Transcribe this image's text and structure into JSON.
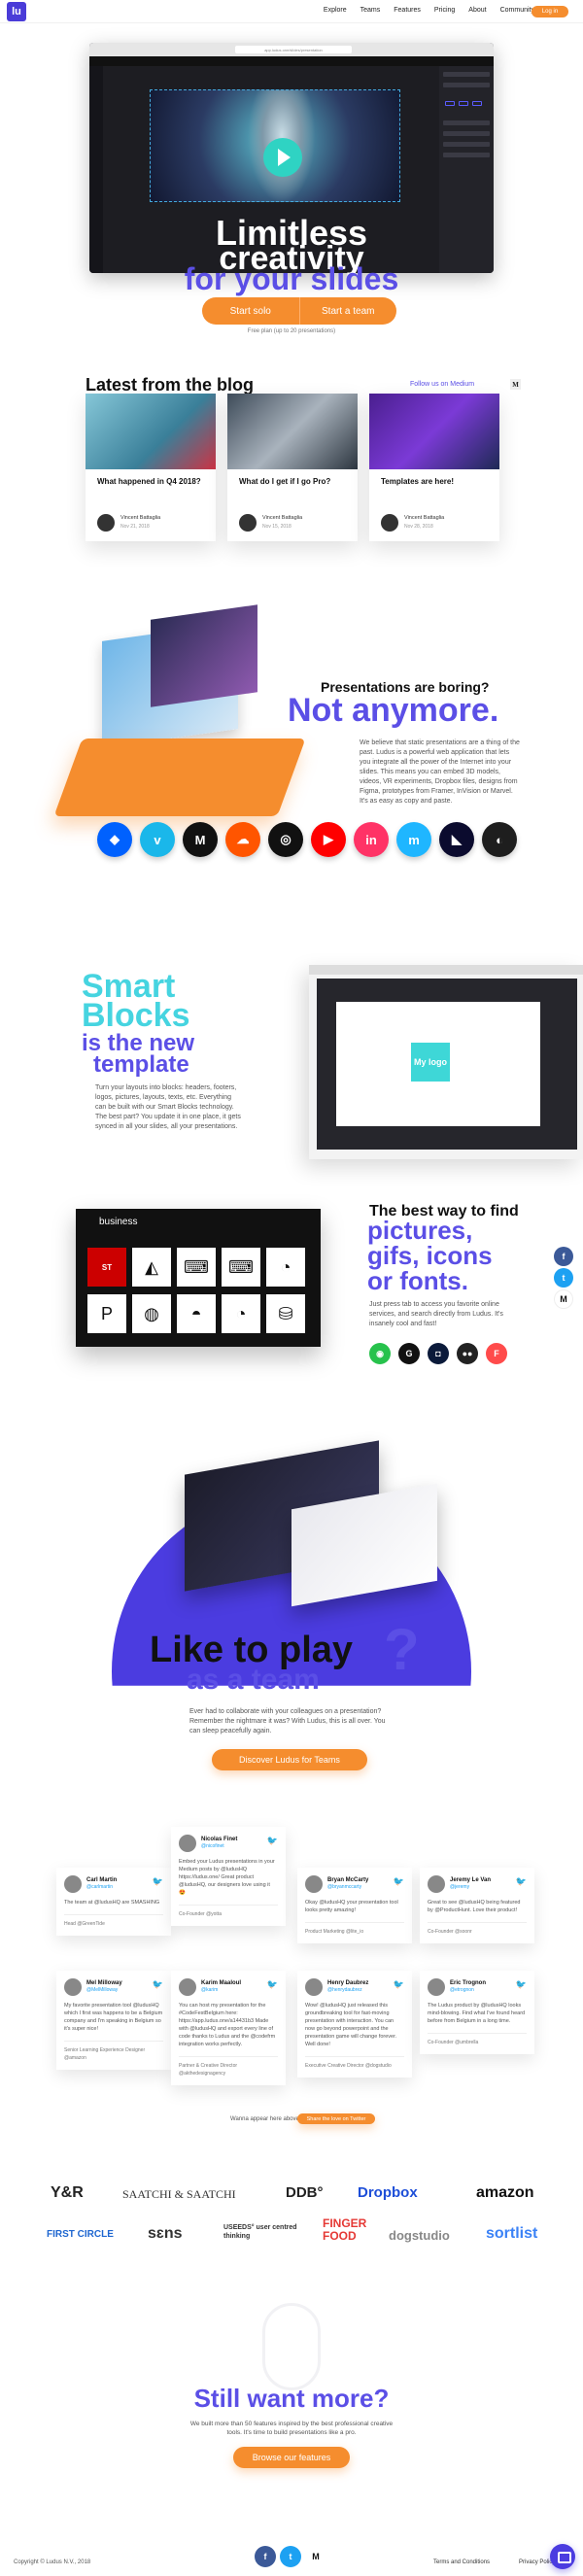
{
  "header": {
    "logo": "lu",
    "nav": [
      "Explore",
      "Teams",
      "Features",
      "Pricing",
      "About",
      "Community"
    ],
    "login": "Log in"
  },
  "hero": {
    "url": "app.ludus.one/slides/presentation",
    "line1": "Limitless",
    "line2": "creativity",
    "line3": "for your slides",
    "btn_solo": "Start solo",
    "btn_team": "Start a team",
    "note": "Free plan (up to 20 presentations)"
  },
  "blog": {
    "title": "Latest from the blog",
    "follow": "Follow us on Medium",
    "m": "M",
    "posts": [
      {
        "title": "What happened in Q4 2018?",
        "author": "Vincent Battaglia",
        "date": "Nov 21, 2018",
        "color": "#5aa9c7"
      },
      {
        "title": "What do I get if I go Pro?",
        "author": "Vincent Battaglia",
        "date": "Nov 15, 2018",
        "color": "#3e4b59"
      },
      {
        "title": "Templates are here!",
        "author": "Vincent Battaglia",
        "date": "Nov 28, 2018",
        "color": "#6b2fb8"
      }
    ]
  },
  "boring": {
    "small": "Presentations are boring?",
    "big": "Not anymore.",
    "para": "We believe that static presentations are a thing of the past. Ludus is a powerful web application that lets you integrate all the power of the Internet into your slides. This means you can embed 3D models, videos, VR experiments, Dropbox files, designs from Figma, prototypes from Framer, InVision or Marvel. It's as easy as copy and paste.",
    "services": [
      {
        "glyph": "◆",
        "color": "#0061fe"
      },
      {
        "glyph": "v",
        "color": "#1ab7ea"
      },
      {
        "glyph": "M",
        "color": "#111111"
      },
      {
        "glyph": "☁",
        "color": "#ff5500"
      },
      {
        "glyph": "◎",
        "color": "#111111"
      },
      {
        "glyph": "▶",
        "color": "#ff0000"
      },
      {
        "glyph": "in",
        "color": "#ff3366"
      },
      {
        "glyph": "m",
        "color": "#1fb6ff"
      },
      {
        "glyph": "◣",
        "color": "#0b0b2e"
      },
      {
        "glyph": "◐",
        "color": "#1e1e1e"
      }
    ]
  },
  "smart": {
    "l1": "Smart",
    "l2": "Blocks",
    "l3": "is the new",
    "l4": "template",
    "para": "Turn your layouts into blocks: headers, footers, logos, pictures, layouts, texts, etc. Everything can be built with our Smart Blocks technology. The best part? You update it in one place, it gets synced in all your slides, all your presentations.",
    "tile": "My logo"
  },
  "find": {
    "search": "business",
    "icons": [
      "ST",
      "◭",
      "⌨",
      "⌨",
      "◔",
      "P",
      "◍",
      "◓",
      "◔",
      "⛁"
    ],
    "l1": "The best way to find",
    "l2": "pictures, gifs, icons or fonts.",
    "para": "Just press tab to access you favorite online services, and search directly from Ludus. It's insanely cool and fast!",
    "sources": [
      {
        "glyph": "◉",
        "color": "#27c24c"
      },
      {
        "glyph": "G",
        "color": "#111111"
      },
      {
        "glyph": "◘",
        "color": "#0b1a3a"
      },
      {
        "glyph": "●●",
        "color": "#222222"
      },
      {
        "glyph": "F",
        "color": "#ff4b4b"
      }
    ],
    "share": [
      {
        "glyph": "f",
        "color": "#3b5998"
      },
      {
        "glyph": "t",
        "color": "#1da1f2"
      },
      {
        "glyph": "M",
        "color": "#111111"
      }
    ]
  },
  "teams": {
    "l1": "Like to play",
    "q": "?",
    "l2": "as a team",
    "para": "Ever had to collaborate with your colleagues on a presentation? Remember the nightmare it was? With Ludus, this is all over. You can sleep peacefully again.",
    "btn": "Discover Ludus for Teams"
  },
  "tweets": [
    {
      "name": "Carl Martin",
      "handle": "@carlmartin",
      "text": "The team at @ludusHQ are SMASHING",
      "foot": "Head @GreenTide"
    },
    {
      "name": "Nicolas Finet",
      "handle": "@nicofinet",
      "text": "Embed your Ludus presentations in your Medium posts by @ludusHQ https://ludus.one/ Great product @ludusHQ, our designers love using it 😍",
      "foot": "Co-Founder @yotta"
    },
    {
      "name": "Bryan McCarty",
      "handle": "@bryanmccarty",
      "text": "Okay @ludusHQ your presentation tool looks pretty amazing!",
      "foot": "Product Marketing @lite_io"
    },
    {
      "name": "Jeremy Le Van",
      "handle": "@jeremy",
      "text": "Great to see @ludusHQ being featured by @ProductHunt. Love their product!",
      "foot": "Co-Founder @soonr"
    },
    {
      "name": "Mel Milloway",
      "handle": "@MelMilloway",
      "text": "My favorite presentation tool @ludusHQ which I first was happens to be a Belgium company and I'm speaking in Belgium so it's super nice!",
      "foot": "Senior Learning Experience Designer @amazon"
    },
    {
      "name": "Karim Maaloul",
      "handle": "@karim",
      "text": "You can host my presentation for the #CodeFestBelgium here: https://app.ludus.one/a14431b3 Made with @ludusHQ and export every line of code thanks to Ludus and the @codefrm integration works perfectly.",
      "foot": "Partner & Creative Director @akthedesignagency"
    },
    {
      "name": "Henry Daubrez",
      "handle": "@henrydaubrez",
      "text": "Wow! @ludusHQ just released this groundbreaking tool for fast-moving presentation with interaction. You can now go beyond powerpoint and the presentation game will change forever. Well done!",
      "foot": "Executive Creative Director @dogstudio"
    },
    {
      "name": "Eric Trognon",
      "handle": "@etrognon",
      "text": "The Ludus product by @ludusHQ looks mind-blowing. Find what I've found heard before from Belgium in a long time.",
      "foot": "Co-Founder @umbrella"
    }
  ],
  "tweet_ask": "Wanna appear here above?",
  "tweet_share": "Share the love on Twitter",
  "logos_row1": [
    "Y&R",
    "SAATCHI & SAATCHI",
    "DDB°",
    "Dropbox",
    "amazon"
  ],
  "logos_row2": [
    "FIRST CIRCLE",
    "sɛns",
    "USEEDS° user centred thinking",
    "FINGER FOOD",
    "dogstudio",
    "sortlist"
  ],
  "more": {
    "title": "Still want more?",
    "para": "We built more than 50 features inspired by the best professional creative tools. It's time to build presentations like a pro.",
    "btn": "Browse our features"
  },
  "footer": {
    "copy": "Copyright © Ludus N.V., 2018",
    "social": [
      {
        "glyph": "f",
        "color": "#3b5998"
      },
      {
        "glyph": "t",
        "color": "#1da1f2"
      },
      {
        "glyph": "M",
        "color": "#111111"
      }
    ],
    "terms": "Terms and Conditions",
    "privacy": "Privacy Policy"
  },
  "colors": {
    "brand": "#5b4fe6",
    "accent": "#f58d2e",
    "cyan": "#46d4e0"
  }
}
